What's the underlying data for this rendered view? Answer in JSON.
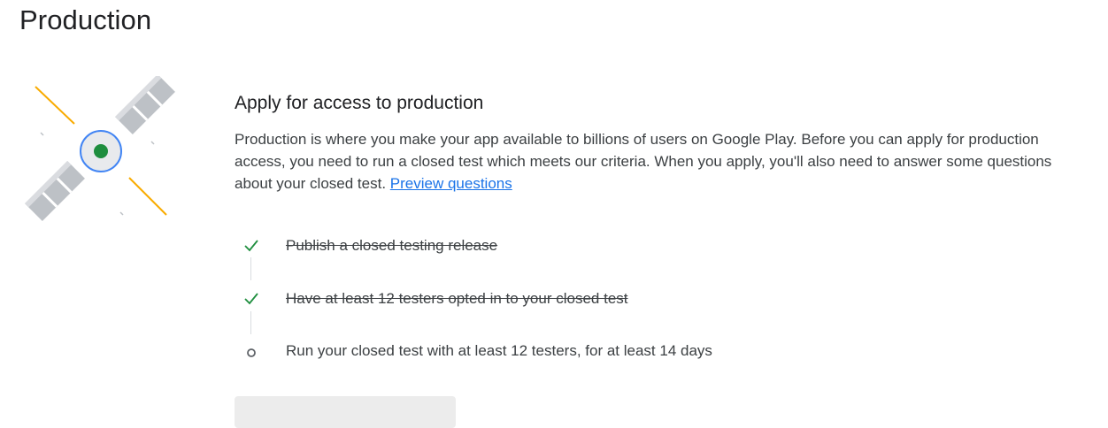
{
  "page": {
    "title": "Production"
  },
  "illustration": {
    "icon": "satellite-icon"
  },
  "apply": {
    "title": "Apply for access to production",
    "description": "Production is where you make your app available to billions of users on Google Play. Before you can apply for production access, you need to run a closed test which meets our criteria. When you apply, you'll also need to answer some questions about your closed test.",
    "preview_link": "Preview questions"
  },
  "checklist": {
    "items": [
      {
        "label": "Publish a closed testing release",
        "status": "done",
        "icon": "check-icon"
      },
      {
        "label": "Have at least 12 testers opted in to your closed test",
        "status": "done",
        "icon": "check-icon"
      },
      {
        "label": "Run your closed test with at least 12 testers, for at least 14 days",
        "status": "pending",
        "icon": "circle-icon"
      }
    ]
  },
  "colors": {
    "check": "#1e8e3e",
    "pending": "#5f6368",
    "link": "#1a73e8",
    "satellite_core": "#1e8e3e",
    "satellite_ring": "#4285f4",
    "satellite_beam": "#f9ab00",
    "solar_panel": "#bdc1c6"
  }
}
